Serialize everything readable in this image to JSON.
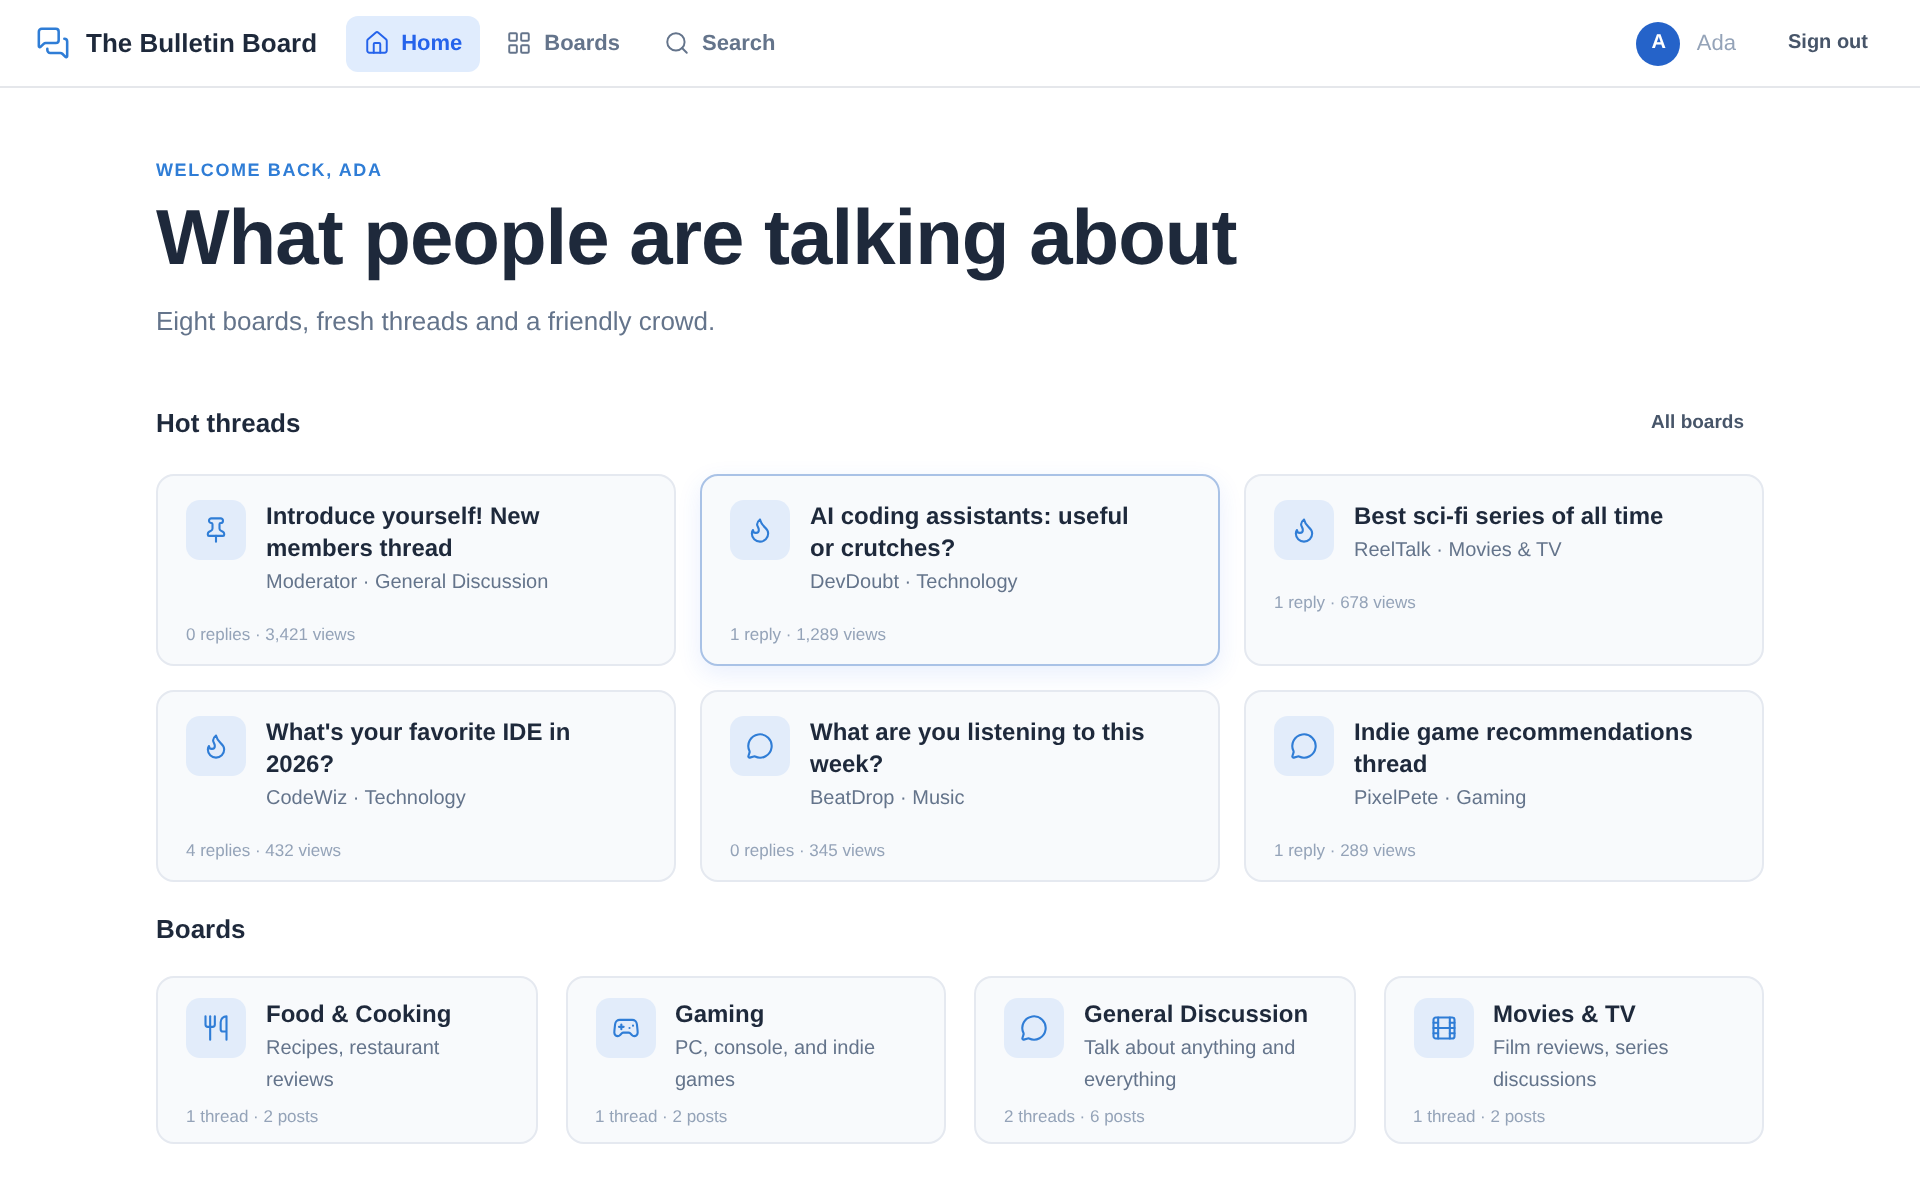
{
  "nav": {
    "brand": "The Bulletin Board",
    "links": [
      {
        "label": "Home",
        "kind": "home",
        "selected": true
      },
      {
        "label": "Boards",
        "kind": "grid",
        "selected": false
      },
      {
        "label": "Search",
        "kind": "search",
        "selected": false
      }
    ],
    "user": {
      "initial": "A",
      "name": "Ada"
    },
    "sign_out": "Sign out"
  },
  "hero": {
    "eyebrow": "WELCOME BACK, ADA",
    "title": "What people are talking about",
    "subtitle": "Eight boards, fresh threads and a friendly crowd."
  },
  "hot_threads": {
    "heading": "Hot threads",
    "link": "All boards",
    "threads": [
      {
        "kind": "pin",
        "title": "Introduce yourself! New members thread",
        "meta": "Moderator · General Discussion",
        "stats": "0 replies · 3,421 views",
        "highlighted": false
      },
      {
        "kind": "flame",
        "title": "AI coding assistants: useful or crutches?",
        "meta": "DevDoubt · Technology",
        "stats": "1 reply · 1,289 views",
        "highlighted": true
      },
      {
        "kind": "flame",
        "title": "Best sci-fi series of all time",
        "meta": "ReelTalk · Movies & TV",
        "stats": "1 reply · 678 views",
        "highlighted": false
      },
      {
        "kind": "flame",
        "title": "What's your favorite IDE in 2026?",
        "meta": "CodeWiz · Technology",
        "stats": "4 replies · 432 views",
        "highlighted": false
      },
      {
        "kind": "chat",
        "title": "What are you listening to this week?",
        "meta": "BeatDrop · Music",
        "stats": "0 replies · 345 views",
        "highlighted": false
      },
      {
        "kind": "chat",
        "title": "Indie game recommendations thread",
        "meta": "PixelPete · Gaming",
        "stats": "1 reply · 289 views",
        "highlighted": false
      }
    ]
  },
  "boards": {
    "heading": "Boards",
    "items": [
      {
        "kind": "food",
        "name": "Food & Cooking",
        "description": "Recipes, restaurant reviews",
        "stats": "1 thread · 2 posts"
      },
      {
        "kind": "game",
        "name": "Gaming",
        "description": "PC, console, and indie games",
        "stats": "1 thread · 2 posts"
      },
      {
        "kind": "chat",
        "name": "General Discussion",
        "description": "Talk about anything and everything",
        "stats": "2 threads · 6 posts"
      },
      {
        "kind": "film",
        "name": "Movies & TV",
        "description": "Film reviews, series discussions",
        "stats": "1 thread · 2 posts"
      }
    ]
  }
}
